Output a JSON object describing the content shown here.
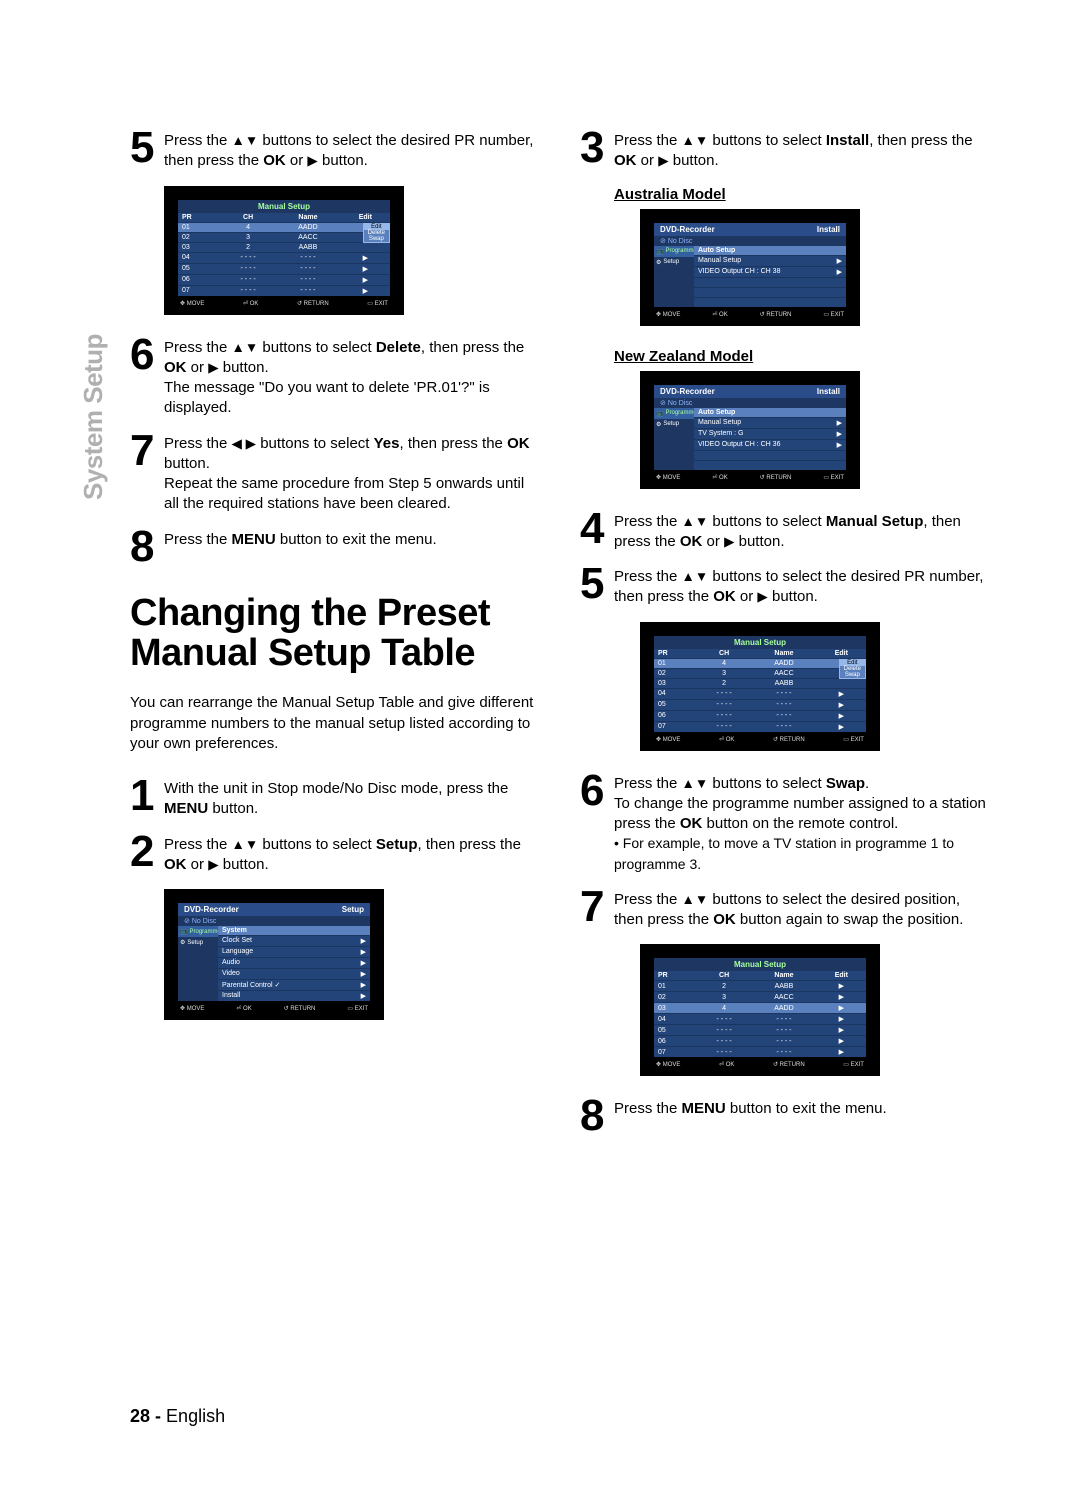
{
  "side_label": "System Setup",
  "page_footer": {
    "num": "28 -",
    "lang": "English"
  },
  "section": {
    "title": "Changing the Preset Manual Setup Table",
    "desc": "You can rearrange the Manual Setup Table and give different programme numbers to the manual setup listed according to your own preferences."
  },
  "steps_left": {
    "s5": {
      "num": "5",
      "l1": "Press the ",
      "l2": " buttons to select the desired PR number, then press the ",
      "b1": "OK",
      "l3": " or ",
      "l4": " button."
    },
    "s6": {
      "num": "6",
      "l1": "Press the ",
      "l2": " buttons to select ",
      "b1": "Delete",
      "l3": ", then press the ",
      "b2": "OK",
      "l4": " or ",
      "l5": " button.",
      "l6": "The message \"Do you want to delete 'PR.01'?\" is displayed."
    },
    "s7": {
      "num": "7",
      "l1": "Press the ",
      "l2": " buttons to select ",
      "b1": "Yes",
      "l3": ", then press the ",
      "b2": "OK",
      "l4": " button.",
      "l5": "Repeat the same procedure from Step 5 onwards until all the required stations have been cleared."
    },
    "s8": {
      "num": "8",
      "l1": "Press the ",
      "b1": "MENU",
      "l2": " button to exit the menu."
    },
    "s1b": {
      "num": "1",
      "l1": "With the unit in Stop mode/No Disc mode, press the ",
      "b1": "MENU",
      "l2": " button."
    },
    "s2b": {
      "num": "2",
      "l1": "Press the ",
      "l2": " buttons to select ",
      "b1": "Setup",
      "l3": ", then press the ",
      "b2": "OK",
      "l4": " or ",
      "l5": " button."
    }
  },
  "steps_right": {
    "s3": {
      "num": "3",
      "l1": "Press the ",
      "l2": " buttons to select ",
      "b1": "Install",
      "l3": ", then press the ",
      "b2": "OK",
      "l4": " or ",
      "l5": " button."
    },
    "model_au": "Australia Model",
    "model_nz": "New Zealand Model",
    "s4": {
      "num": "4",
      "l1": "Press the ",
      "l2": " buttons to select ",
      "b1": "Manual Setup",
      "l3": ", then press the ",
      "b2": "OK",
      "l4": " or ",
      "l5": " button."
    },
    "s5": {
      "num": "5",
      "l1": "Press the ",
      "l2": " buttons to select the desired PR number, then press the ",
      "b1": "OK",
      "l3": " or ",
      "l4": " button."
    },
    "s6": {
      "num": "6",
      "l1": "Press the ",
      "l2": " buttons to select ",
      "b1": "Swap",
      "l3": ".",
      "l4": "To change the programme number assigned to a station press the ",
      "b2": "OK",
      "l5": " button on the remote control.",
      "note": "• For example, to move a TV station in programme 1 to programme 3."
    },
    "s7": {
      "num": "7",
      "l1": "Press the ",
      "l2": " buttons to select the desired position, then press the ",
      "b1": "OK",
      "l3": " button again to swap the position."
    },
    "s8": {
      "num": "8",
      "l1": "Press the ",
      "b1": "MENU",
      "l2": " button to exit the menu."
    }
  },
  "osd_common": {
    "footer": {
      "move": "MOVE",
      "ok": "OK",
      "ret": "RETURN",
      "exit": "EXIT"
    },
    "sidebar": {
      "prog": "Programme",
      "setup": "Setup"
    },
    "titlebar": {
      "rec": "DVD-Recorder",
      "nodisc": "No Disc"
    }
  },
  "osd_setup": {
    "corner": "Setup",
    "head": "System",
    "rows": [
      "Clock Set",
      "Language",
      "Audio",
      "Video",
      "Parental Control ✓",
      "Install"
    ]
  },
  "osd_install_au": {
    "corner": "Install",
    "head": "Auto Setup",
    "rows": [
      "Manual Setup",
      "VIDEO Output CH  : CH 38"
    ]
  },
  "osd_install_nz": {
    "corner": "Install",
    "head": "Auto Setup",
    "rows": [
      "Manual Setup",
      "TV System  : G",
      "VIDEO Output CH  : CH 36"
    ]
  },
  "ms_table": {
    "title": "Manual Setup",
    "headers": [
      "PR",
      "CH",
      "Name",
      "Edit"
    ],
    "popup": [
      "Edit",
      "Delete",
      "Swap"
    ],
    "data_a": [
      [
        "01",
        "4",
        "AADD"
      ],
      [
        "02",
        "3",
        "AACC"
      ],
      [
        "03",
        "2",
        "AABB"
      ],
      [
        "04",
        "- - - -",
        "- - - -"
      ],
      [
        "05",
        "- - - -",
        "- - - -"
      ],
      [
        "06",
        "- - - -",
        "- - - -"
      ],
      [
        "07",
        "- - - -",
        "- - - -"
      ]
    ],
    "data_b": [
      [
        "01",
        "2",
        "AABB"
      ],
      [
        "02",
        "3",
        "AACC"
      ],
      [
        "03",
        "4",
        "AADD"
      ],
      [
        "04",
        "- - - -",
        "- - - -"
      ],
      [
        "05",
        "- - - -",
        "- - - -"
      ],
      [
        "06",
        "- - - -",
        "- - - -"
      ],
      [
        "07",
        "- - - -",
        "- - - -"
      ]
    ]
  }
}
